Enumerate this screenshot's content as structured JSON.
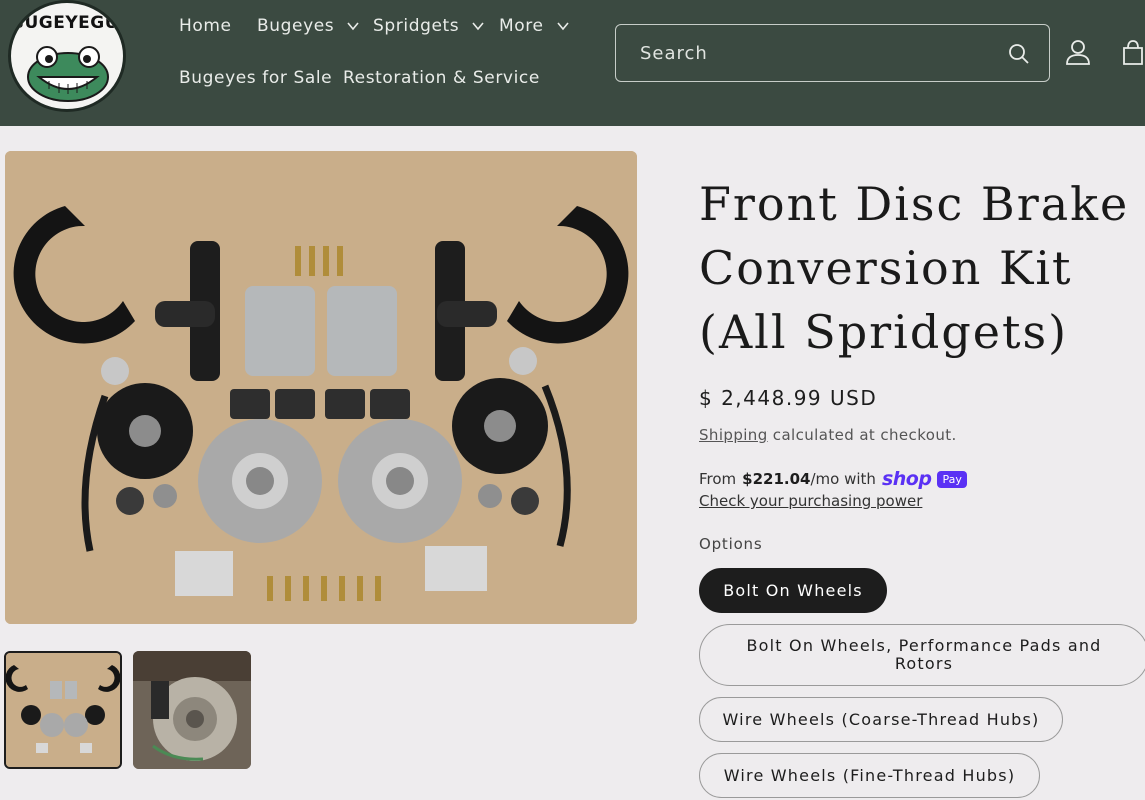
{
  "header": {
    "logo_text": "BUGEYEGUYS",
    "nav": [
      {
        "label": "Home"
      },
      {
        "label": "Bugeyes"
      },
      {
        "label": "Spridgets"
      },
      {
        "label": "More"
      },
      {
        "label": "Bugeyes for Sale"
      },
      {
        "label": "Restoration & Service"
      }
    ],
    "search_placeholder": "Search",
    "icons": [
      "search-icon",
      "account-icon",
      "cart-icon",
      "chevron-down-icon"
    ]
  },
  "product": {
    "title": "Front Disc Brake Conversion Kit (All Spridgets)",
    "price": "$ 2,448.99 USD",
    "shipping_link": "Shipping",
    "shipping_text": " calculated at checkout.",
    "installments_from": "From",
    "installments_amount": "$221.04",
    "installments_suffix": "/mo with",
    "shop_label": "shop",
    "pay_label": "Pay",
    "check_power": "Check your purchasing power",
    "options_label": "Options",
    "options": [
      {
        "label": "Bolt On Wheels",
        "selected": true
      },
      {
        "label": "Bolt On Wheels, Performance Pads and Rotors",
        "selected": false
      },
      {
        "label": "Wire Wheels (Coarse-Thread Hubs)",
        "selected": false
      },
      {
        "label": "Wire Wheels (Fine-Thread Hubs)",
        "selected": false
      }
    ]
  },
  "colors": {
    "header_bg": "#3b4a41",
    "page_bg": "#eeecee",
    "shop_pay": "#5a31f4",
    "selected_option": "#1d1d1d"
  }
}
